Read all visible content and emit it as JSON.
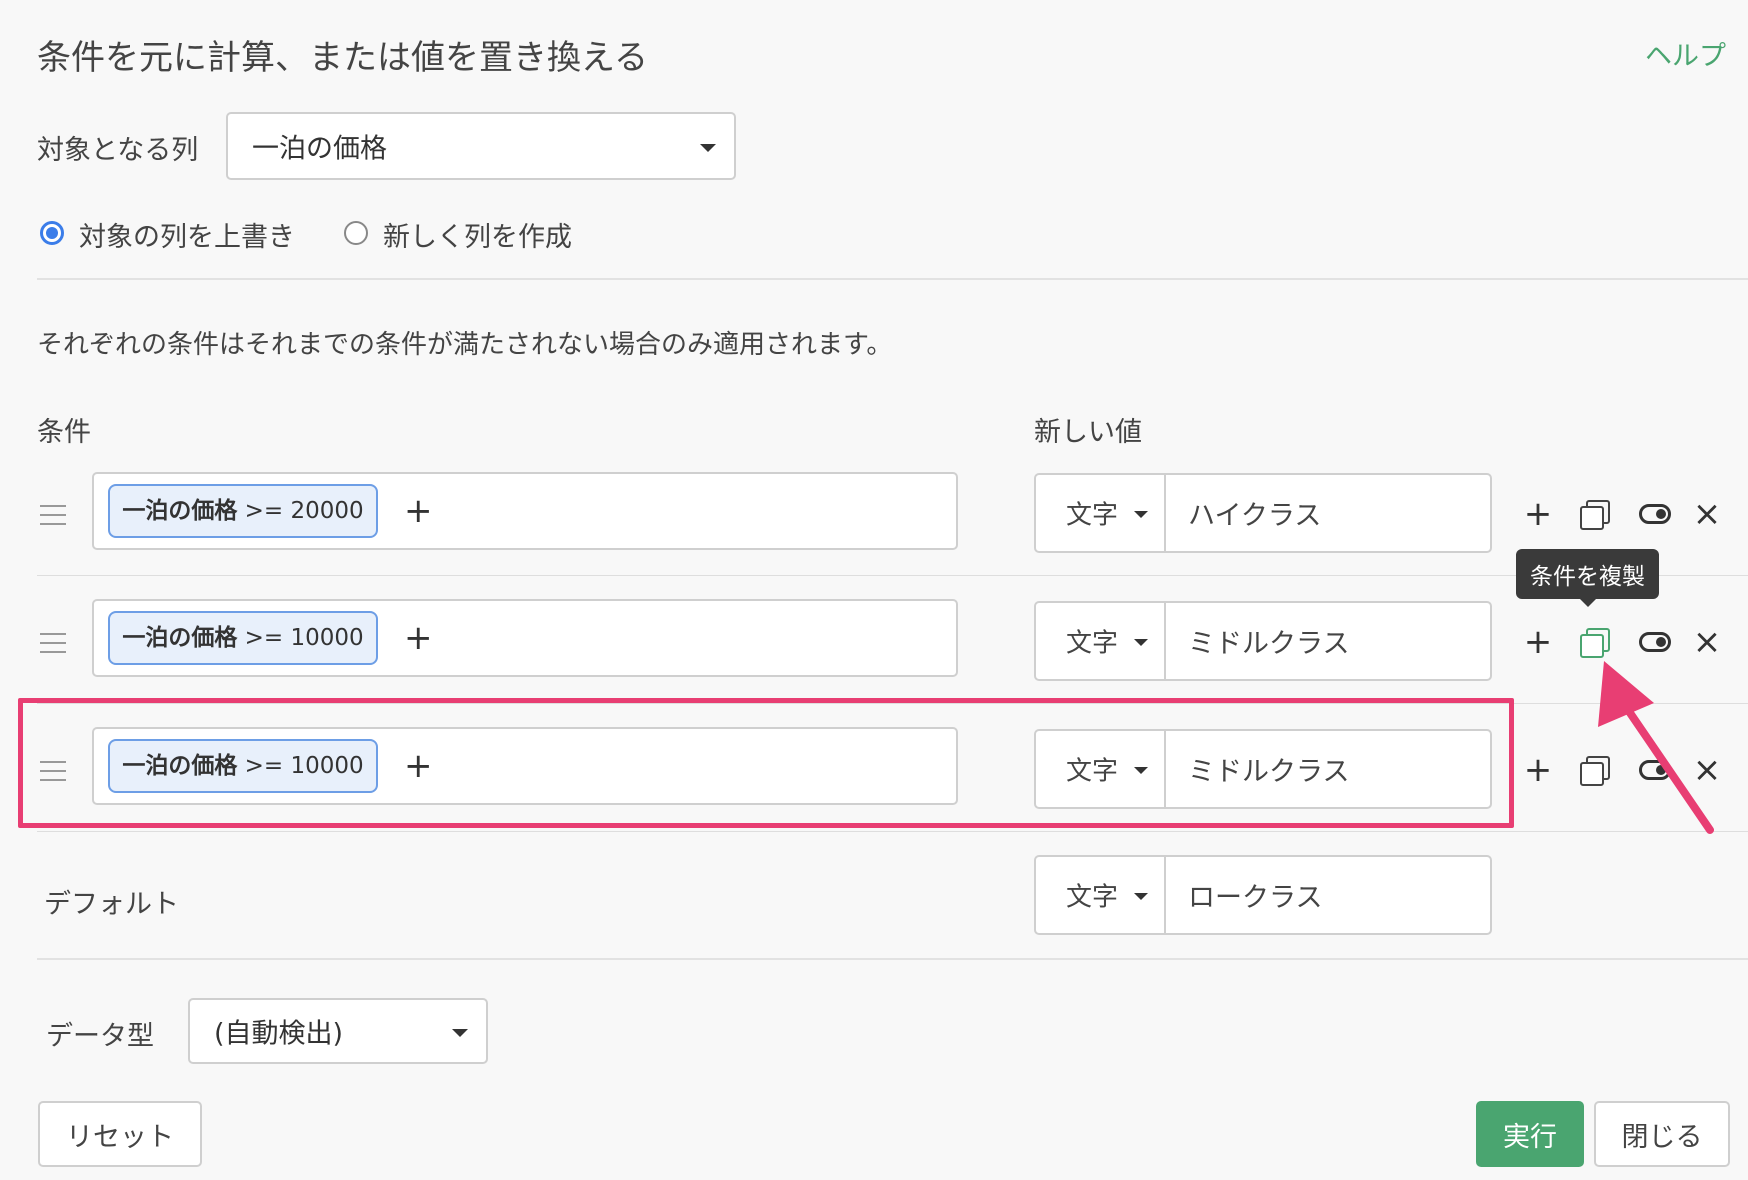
{
  "dialog": {
    "title": "条件を元に計算、または値を置き換える",
    "help_label": "ヘルプ"
  },
  "target": {
    "label": "対象となる列",
    "value": "一泊の価格"
  },
  "mode": {
    "overwrite_label": "対象の列を上書き",
    "new_column_label": "新しく列を作成",
    "selected": "overwrite"
  },
  "description": "それぞれの条件はそれまでの条件が満たされない場合のみ適用されます。",
  "headers": {
    "condition": "条件",
    "new_value": "新しい値"
  },
  "rules": [
    {
      "column": "一泊の価格",
      "operator": ">=",
      "threshold": "20000",
      "type": "文字",
      "value": "ハイクラス"
    },
    {
      "column": "一泊の価格",
      "operator": ">=",
      "threshold": "10000",
      "type": "文字",
      "value": "ミドルクラス"
    },
    {
      "column": "一泊の価格",
      "operator": ">=",
      "threshold": "10000",
      "type": "文字",
      "value": "ミドルクラス"
    }
  ],
  "tooltip": "条件を複製",
  "default_row": {
    "label": "デフォルト",
    "type": "文字",
    "value": "ロークラス"
  },
  "data_type": {
    "label": "データ型",
    "value": "(自動検出)"
  },
  "buttons": {
    "reset": "リセット",
    "run": "実行",
    "close": "閉じる"
  },
  "colors": {
    "accent": "#4aa570",
    "highlight": "#e83e73",
    "radio": "#3b7de9",
    "chip_border": "#6d9ee6"
  }
}
